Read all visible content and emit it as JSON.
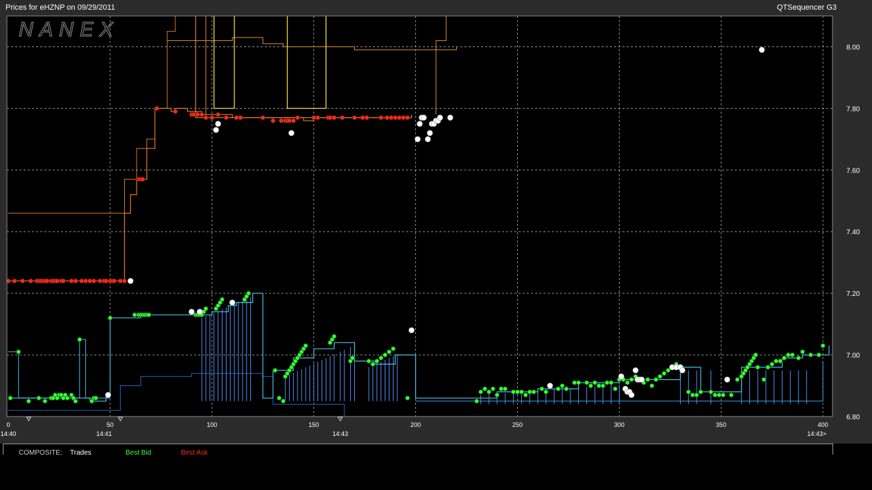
{
  "header": {
    "title": "Prices for  eHZNP  on  09/29/2011",
    "app_name": "QTSequencer G3"
  },
  "watermark": "NANEX",
  "legend": {
    "composite": "COMPOSITE:",
    "trades": "Trades",
    "best_bid": "Best Bid",
    "best_ask": "Best Ask"
  },
  "colors": {
    "background": "#000000",
    "frame": "#2b2b2b",
    "grid": "#bdbdbd",
    "trades": "#ffffff",
    "best_bid": "#3aff3a",
    "best_ask": "#ff2a1a",
    "bid_lines": "#3a7fe0",
    "ask_lines": "#f0a030"
  },
  "chart_data": {
    "type": "line",
    "title": "Prices for  eHZNP  on  09/29/2011",
    "xlim": [
      0,
      403
    ],
    "ylim": [
      6.8,
      8.1
    ],
    "x_ticks": [
      0,
      50,
      100,
      150,
      200,
      250,
      300,
      350,
      400
    ],
    "y_ticks": [
      6.8,
      7.0,
      7.2,
      7.4,
      7.6,
      7.8,
      8.0
    ],
    "time_labels": [
      {
        "x": 0,
        "label": "14:40"
      },
      {
        "x": 47,
        "label": "14:41"
      },
      {
        "x": 163,
        "label": "14:43"
      },
      {
        "x": 397,
        "label": "14:43>"
      }
    ],
    "grid": true,
    "series": [
      {
        "name": "Best Ask",
        "step": [
          [
            0,
            7.24
          ],
          [
            57,
            7.24
          ],
          [
            57,
            7.46
          ],
          [
            60,
            7.52
          ],
          [
            63,
            7.57
          ],
          [
            68,
            7.67
          ],
          [
            72,
            7.8
          ],
          [
            80,
            7.8
          ],
          [
            80,
            7.79
          ],
          [
            82,
            7.8
          ],
          [
            88,
            7.79
          ],
          [
            95,
            7.78
          ],
          [
            110,
            7.77
          ],
          [
            125,
            7.77
          ],
          [
            145,
            7.76
          ],
          [
            150,
            7.77
          ],
          [
            198,
            7.77
          ]
        ],
        "markers": [
          [
            0,
            7.24
          ],
          [
            3,
            7.24
          ],
          [
            7,
            7.24
          ],
          [
            11,
            7.24
          ],
          [
            14,
            7.24
          ],
          [
            15,
            7.24
          ],
          [
            16,
            7.24
          ],
          [
            17,
            7.24
          ],
          [
            18,
            7.24
          ],
          [
            19,
            7.24
          ],
          [
            21,
            7.24
          ],
          [
            22,
            7.24
          ],
          [
            23,
            7.24
          ],
          [
            24,
            7.24
          ],
          [
            26,
            7.24
          ],
          [
            27,
            7.24
          ],
          [
            31,
            7.24
          ],
          [
            33,
            7.24
          ],
          [
            36,
            7.24
          ],
          [
            38,
            7.24
          ],
          [
            40,
            7.24
          ],
          [
            42,
            7.24
          ],
          [
            45,
            7.24
          ],
          [
            47,
            7.24
          ],
          [
            48,
            7.24
          ],
          [
            50,
            7.24
          ],
          [
            51,
            7.24
          ],
          [
            52,
            7.24
          ],
          [
            55,
            7.24
          ],
          [
            57,
            7.24
          ],
          [
            64,
            7.57
          ],
          [
            65,
            7.57
          ],
          [
            66,
            7.57
          ],
          [
            73,
            7.8
          ],
          [
            82,
            7.79
          ],
          [
            90,
            7.78
          ],
          [
            91,
            7.78
          ],
          [
            93,
            7.78
          ],
          [
            95,
            7.78
          ],
          [
            97,
            7.77
          ],
          [
            100,
            7.77
          ],
          [
            103,
            7.78
          ],
          [
            107,
            7.77
          ],
          [
            112,
            7.77
          ],
          [
            114,
            7.77
          ],
          [
            125,
            7.77
          ],
          [
            130,
            7.76
          ],
          [
            134,
            7.76
          ],
          [
            136,
            7.76
          ],
          [
            137,
            7.76
          ],
          [
            138,
            7.76
          ],
          [
            140,
            7.76
          ],
          [
            142,
            7.77
          ],
          [
            150,
            7.77
          ],
          [
            152,
            7.77
          ],
          [
            157,
            7.77
          ],
          [
            158,
            7.77
          ],
          [
            160,
            7.77
          ],
          [
            164,
            7.77
          ],
          [
            170,
            7.77
          ],
          [
            174,
            7.77
          ],
          [
            176,
            7.77
          ],
          [
            183,
            7.77
          ],
          [
            186,
            7.77
          ],
          [
            188,
            7.77
          ],
          [
            190,
            7.77
          ],
          [
            192,
            7.77
          ],
          [
            194,
            7.77
          ],
          [
            196,
            7.77
          ]
        ]
      },
      {
        "name": "Best Bid",
        "step": [
          [
            0,
            6.86
          ],
          [
            40,
            6.86
          ],
          [
            40,
            6.85
          ],
          [
            45,
            6.85
          ],
          [
            48,
            6.87
          ],
          [
            50,
            6.87
          ],
          [
            50,
            7.12
          ],
          [
            62,
            7.12
          ],
          [
            65,
            7.13
          ],
          [
            70,
            7.13
          ],
          [
            95,
            7.13
          ],
          [
            100,
            7.14
          ],
          [
            105,
            7.14
          ],
          [
            108,
            7.16
          ],
          [
            112,
            7.17
          ],
          [
            120,
            7.2
          ],
          [
            125,
            6.86
          ],
          [
            130,
            6.95
          ],
          [
            140,
            6.99
          ],
          [
            150,
            7.02
          ],
          [
            160,
            7.04
          ],
          [
            170,
            6.98
          ],
          [
            180,
            6.97
          ],
          [
            190,
            7.0
          ],
          [
            200,
            6.86
          ],
          [
            225,
            6.86
          ],
          [
            240,
            6.88
          ],
          [
            260,
            6.89
          ],
          [
            280,
            6.91
          ],
          [
            300,
            6.92
          ],
          [
            330,
            6.96
          ],
          [
            340,
            6.88
          ],
          [
            360,
            6.96
          ],
          [
            380,
            6.99
          ],
          [
            390,
            7.0
          ],
          [
            403,
            7.03
          ]
        ],
        "markers": [
          [
            1,
            6.86
          ],
          [
            5,
            7.01
          ],
          [
            10,
            6.85
          ],
          [
            15,
            6.86
          ],
          [
            18,
            6.85
          ],
          [
            21,
            6.86
          ],
          [
            22,
            6.86
          ],
          [
            23,
            6.87
          ],
          [
            24,
            6.86
          ],
          [
            25,
            6.87
          ],
          [
            26,
            6.87
          ],
          [
            27,
            6.86
          ],
          [
            28,
            6.87
          ],
          [
            29,
            6.86
          ],
          [
            31,
            6.87
          ],
          [
            32,
            6.86
          ],
          [
            33,
            6.85
          ],
          [
            35,
            7.05
          ],
          [
            41,
            6.85
          ],
          [
            42,
            6.86
          ],
          [
            43,
            6.86
          ],
          [
            50,
            7.12
          ],
          [
            62,
            7.13
          ],
          [
            64,
            7.13
          ],
          [
            65,
            7.13
          ],
          [
            66,
            7.13
          ],
          [
            67,
            7.13
          ],
          [
            68,
            7.13
          ],
          [
            69,
            7.13
          ],
          [
            92,
            7.13
          ],
          [
            93,
            7.13
          ],
          [
            94,
            7.13
          ],
          [
            95,
            7.13
          ],
          [
            96,
            7.14
          ],
          [
            97,
            7.15
          ],
          [
            102,
            7.15
          ],
          [
            103,
            7.16
          ],
          [
            104,
            7.17
          ],
          [
            105,
            7.18
          ],
          [
            116,
            7.18
          ],
          [
            117,
            7.19
          ],
          [
            118,
            7.2
          ],
          [
            131,
            6.95
          ],
          [
            133,
            6.86
          ],
          [
            135,
            6.85
          ],
          [
            136,
            6.93
          ],
          [
            137,
            6.94
          ],
          [
            138,
            6.95
          ],
          [
            139,
            6.96
          ],
          [
            140,
            6.97
          ],
          [
            141,
            6.98
          ],
          [
            142,
            6.99
          ],
          [
            143,
            7.0
          ],
          [
            144,
            7.01
          ],
          [
            145,
            7.02
          ],
          [
            146,
            7.03
          ],
          [
            158,
            7.04
          ],
          [
            159,
            7.05
          ],
          [
            160,
            7.06
          ],
          [
            168,
            6.98
          ],
          [
            169,
            6.99
          ],
          [
            177,
            6.98
          ],
          [
            179,
            6.97
          ],
          [
            181,
            6.98
          ],
          [
            183,
            6.99
          ],
          [
            185,
            7.0
          ],
          [
            187,
            7.01
          ],
          [
            189,
            7.02
          ],
          [
            196,
            6.86
          ],
          [
            230,
            6.85
          ],
          [
            232,
            6.88
          ],
          [
            234,
            6.89
          ],
          [
            236,
            6.88
          ],
          [
            238,
            6.89
          ],
          [
            240,
            6.87
          ],
          [
            242,
            6.89
          ],
          [
            244,
            6.89
          ],
          [
            248,
            6.88
          ],
          [
            250,
            6.88
          ],
          [
            252,
            6.88
          ],
          [
            254,
            6.87
          ],
          [
            256,
            6.88
          ],
          [
            258,
            6.88
          ],
          [
            262,
            6.89
          ],
          [
            264,
            6.88
          ],
          [
            270,
            6.89
          ],
          [
            272,
            6.9
          ],
          [
            274,
            6.89
          ],
          [
            278,
            6.91
          ],
          [
            280,
            6.91
          ],
          [
            284,
            6.91
          ],
          [
            286,
            6.9
          ],
          [
            288,
            6.91
          ],
          [
            290,
            6.9
          ],
          [
            292,
            6.9
          ],
          [
            294,
            6.91
          ],
          [
            296,
            6.91
          ],
          [
            298,
            6.89
          ],
          [
            300,
            6.92
          ],
          [
            302,
            6.92
          ],
          [
            304,
            6.91
          ],
          [
            306,
            6.92
          ],
          [
            308,
            6.93
          ],
          [
            312,
            6.91
          ],
          [
            314,
            6.92
          ],
          [
            316,
            6.9
          ],
          [
            318,
            6.92
          ],
          [
            320,
            6.93
          ],
          [
            322,
            6.94
          ],
          [
            324,
            6.95
          ],
          [
            326,
            6.96
          ],
          [
            328,
            6.97
          ],
          [
            330,
            6.96
          ],
          [
            334,
            6.88
          ],
          [
            336,
            6.87
          ],
          [
            338,
            6.87
          ],
          [
            340,
            6.88
          ],
          [
            345,
            6.88
          ],
          [
            347,
            6.87
          ],
          [
            349,
            6.87
          ],
          [
            351,
            6.87
          ],
          [
            355,
            6.87
          ],
          [
            358,
            6.92
          ],
          [
            360,
            6.93
          ],
          [
            361,
            6.94
          ],
          [
            362,
            6.95
          ],
          [
            363,
            6.96
          ],
          [
            364,
            6.97
          ],
          [
            365,
            6.98
          ],
          [
            366,
            6.99
          ],
          [
            367,
            7.0
          ],
          [
            368,
            6.96
          ],
          [
            371,
            6.92
          ],
          [
            373,
            6.96
          ],
          [
            375,
            6.97
          ],
          [
            377,
            6.98
          ],
          [
            379,
            6.98
          ],
          [
            381,
            6.99
          ],
          [
            383,
            7.0
          ],
          [
            385,
            7.0
          ],
          [
            388,
            6.99
          ],
          [
            390,
            7.01
          ],
          [
            394,
            7.0
          ],
          [
            398,
            7.0
          ],
          [
            400,
            7.03
          ]
        ]
      },
      {
        "name": "Trades",
        "markers": [
          [
            60,
            7.24
          ],
          [
            49,
            6.87
          ],
          [
            90,
            7.14
          ],
          [
            94,
            7.14
          ],
          [
            110,
            7.17
          ],
          [
            102,
            7.73
          ],
          [
            103,
            7.75
          ],
          [
            139,
            7.72
          ],
          [
            198,
            7.08
          ],
          [
            201,
            7.7
          ],
          [
            202,
            7.75
          ],
          [
            203,
            7.77
          ],
          [
            204,
            7.77
          ],
          [
            206,
            7.7
          ],
          [
            207,
            7.72
          ],
          [
            208,
            7.75
          ],
          [
            209,
            7.75
          ],
          [
            210,
            7.76
          ],
          [
            211,
            7.76
          ],
          [
            212,
            7.77
          ],
          [
            217,
            7.77
          ],
          [
            266,
            6.9
          ],
          [
            301,
            6.93
          ],
          [
            303,
            6.89
          ],
          [
            304,
            6.88
          ],
          [
            305,
            6.88
          ],
          [
            306,
            6.87
          ],
          [
            308,
            6.95
          ],
          [
            309,
            6.92
          ],
          [
            310,
            6.92
          ],
          [
            311,
            6.92
          ],
          [
            326,
            6.96
          ],
          [
            328,
            6.96
          ],
          [
            330,
            6.96
          ],
          [
            331,
            6.95
          ],
          [
            353,
            6.92
          ],
          [
            370,
            7.99
          ]
        ]
      }
    ]
  }
}
